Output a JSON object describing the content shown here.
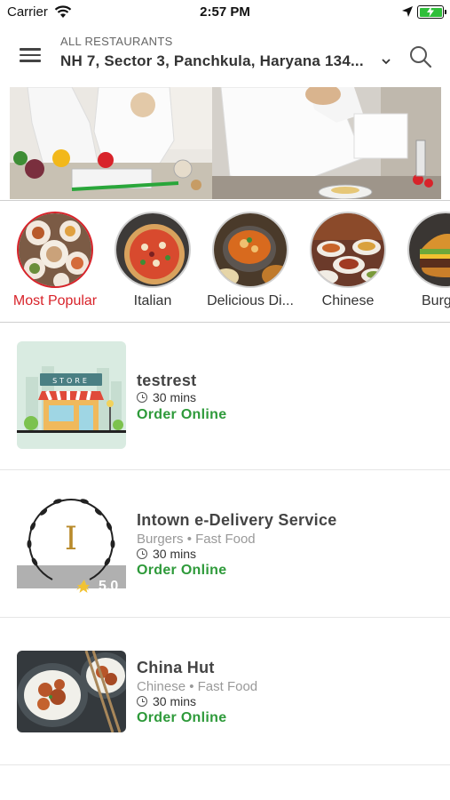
{
  "status": {
    "carrier": "Carrier",
    "time": "2:57 PM"
  },
  "header": {
    "caption": "ALL RESTAURANTS",
    "address": "NH 7, Sector 3, Panchkula, Haryana 134..."
  },
  "categories": [
    {
      "label": "Most Popular",
      "active": true
    },
    {
      "label": "Italian"
    },
    {
      "label": "Delicious Di..."
    },
    {
      "label": "Chinese"
    },
    {
      "label": "Burg"
    }
  ],
  "restaurants": [
    {
      "name": "testrest",
      "cuisine": "",
      "time": "30 mins",
      "order": "Order Online"
    },
    {
      "name": "Intown e-Delivery Service",
      "cuisine": "Burgers • Fast Food",
      "time": "30 mins",
      "order": "Order Online",
      "logo_letter": "I",
      "rating": "5.0"
    },
    {
      "name": "China Hut",
      "cuisine": "Chinese • Fast Food",
      "time": "30 mins",
      "order": "Order Online"
    }
  ],
  "colors": {
    "accent_red": "#d8232a",
    "order_green": "#2e9a3a"
  },
  "store_sign": "STORE"
}
